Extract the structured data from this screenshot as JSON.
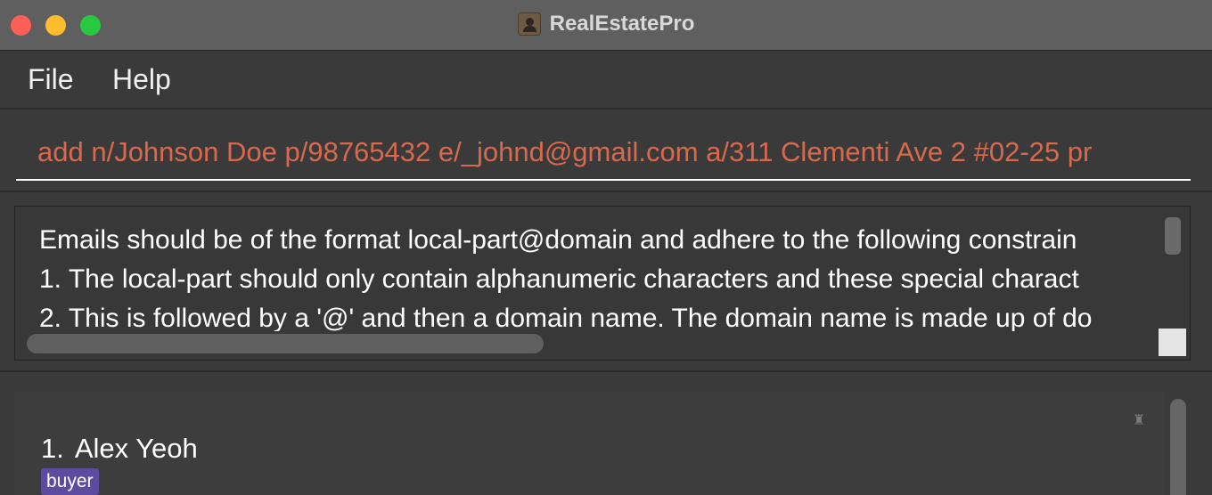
{
  "window": {
    "title": "RealEstatePro",
    "app_icon": "contact-book-icon"
  },
  "menu": {
    "items": [
      {
        "label": "File"
      },
      {
        "label": "Help"
      }
    ]
  },
  "command_box": {
    "value": "add n/Johnson Doe p/98765432 e/_johnd@gmail.com a/311 Clementi Ave 2 #02-25 pr",
    "text_color": "#d8694d"
  },
  "result_display": {
    "lines": [
      "Emails should be of the format local-part@domain and adhere to the following constrain",
      "1. The local-part should only contain alphanumeric characters and these special charact",
      "2. This is followed by a '@' and then a domain name. The domain name is made up of do"
    ]
  },
  "person_list": {
    "people": [
      {
        "index": "1.",
        "name": "Alex Yeoh",
        "tags": [
          "buyer"
        ]
      }
    ],
    "tag_color": "#5c4b9e",
    "card_icon": "pin-icon"
  },
  "colors": {
    "titlebar": "#5f5f5f",
    "background": "#3a3a3a",
    "traffic_red": "#fe5f57",
    "traffic_yellow": "#febc2e",
    "traffic_green": "#28c840"
  }
}
